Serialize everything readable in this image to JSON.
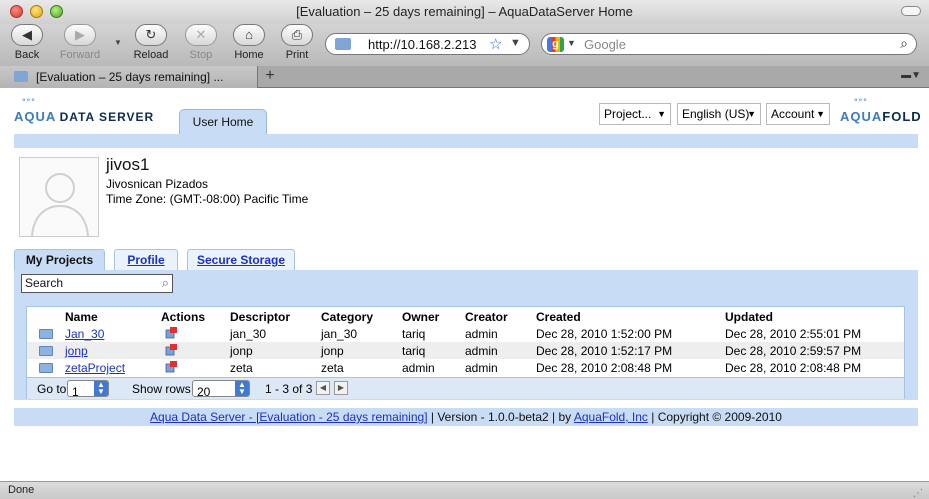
{
  "window": {
    "title": "[Evaluation – 25 days remaining] – AquaDataServer Home"
  },
  "toolbar": {
    "back": "Back",
    "forward": "Forward",
    "reload": "Reload",
    "stop": "Stop",
    "home": "Home",
    "print": "Print",
    "url": "http://10.168.2.213",
    "search_placeholder": "Google"
  },
  "tabbar": {
    "tab_title": "[Evaluation – 25 days remaining] ...",
    "new_tab": "+"
  },
  "header": {
    "logo_left_aqua": "AQUA",
    "logo_left_rest": "DATA SERVER",
    "user_home_tab": "User Home",
    "menus": [
      "Project...",
      "English (US)",
      "Account"
    ],
    "logo_right_aqua": "AQUA",
    "logo_right_rest": "FOLD"
  },
  "user": {
    "username": "jivos1",
    "full_name": "Jivosnican Pizados",
    "timezone": "Time Zone: (GMT:-08:00) Pacific Time"
  },
  "tabs": [
    "My Projects",
    "Profile",
    "Secure Storage"
  ],
  "search": {
    "value": "Search"
  },
  "table": {
    "columns": [
      "Name",
      "Actions",
      "Descriptor",
      "Category",
      "Owner",
      "Creator",
      "Created",
      "Updated"
    ],
    "rows": [
      {
        "name": "Jan_30",
        "descriptor": "jan_30",
        "category": "jan_30",
        "owner": "tariq",
        "creator": "admin",
        "created": "Dec 28, 2010 1:52:00 PM",
        "updated": "Dec 28, 2010 2:55:01 PM"
      },
      {
        "name": "jonp",
        "descriptor": "jonp",
        "category": "jonp",
        "owner": "tariq",
        "creator": "admin",
        "created": "Dec 28, 2010 1:52:17 PM",
        "updated": "Dec 28, 2010 2:59:57 PM"
      },
      {
        "name": "zetaProject",
        "descriptor": "zeta",
        "category": "zeta",
        "owner": "admin",
        "creator": "admin",
        "created": "Dec 28, 2010 2:08:48 PM",
        "updated": "Dec 28, 2010 2:08:48 PM"
      }
    ]
  },
  "pager": {
    "goto_label": "Go to",
    "goto_value": "1",
    "rows_label": "Show rows",
    "rows_value": "20",
    "range": "1 - 3 of 3"
  },
  "footer": {
    "link1": "Aqua Data Server - [Evaluation - 25 days remaining]",
    "version": " | Version - 1.0.0-beta2 | by ",
    "link2": "AquaFold, Inc",
    "copyright": " | Copyright © 2009-2010"
  },
  "status": {
    "text": "Done"
  },
  "colors": {
    "band": "#c9dcf5",
    "link": "#1a31c5",
    "brand_blue": "#3b7bbf",
    "brand_dark": "#0b2b52"
  }
}
